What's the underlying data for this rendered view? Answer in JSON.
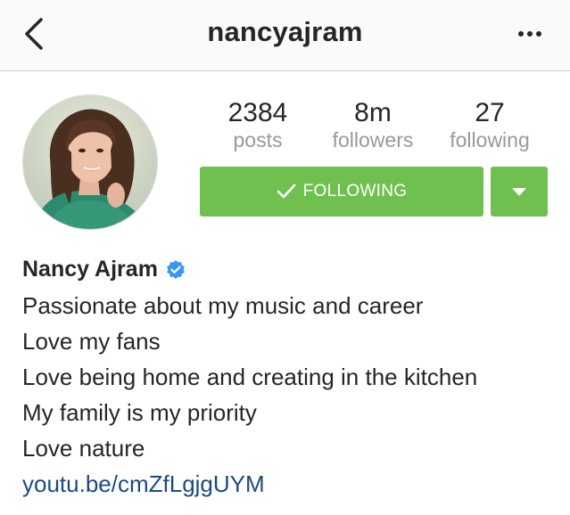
{
  "header": {
    "username": "nancyajram",
    "back_icon": "chevron-left-icon",
    "more_icon": "more-dots-icon"
  },
  "profile": {
    "avatar_alt": "profile-photo",
    "stats": [
      {
        "value": "2384",
        "label": "posts"
      },
      {
        "value": "8m",
        "label": "followers"
      },
      {
        "value": "27",
        "label": "following"
      }
    ],
    "follow_button_label": "FOLLOWING",
    "follow_icon": "checkmark-icon",
    "dropdown_icon": "caret-down-icon",
    "accent_color": "#70c050"
  },
  "bio": {
    "name": "Nancy Ajram",
    "verified_icon": "verified-badge-icon",
    "lines": [
      "Passionate about my music and career",
      "Love my fans",
      "Love being home and creating in the kitchen",
      "My family is my priority",
      "Love nature"
    ],
    "link": "youtu.be/cmZfLgjgUYM",
    "link_color": "#1c4a82"
  }
}
